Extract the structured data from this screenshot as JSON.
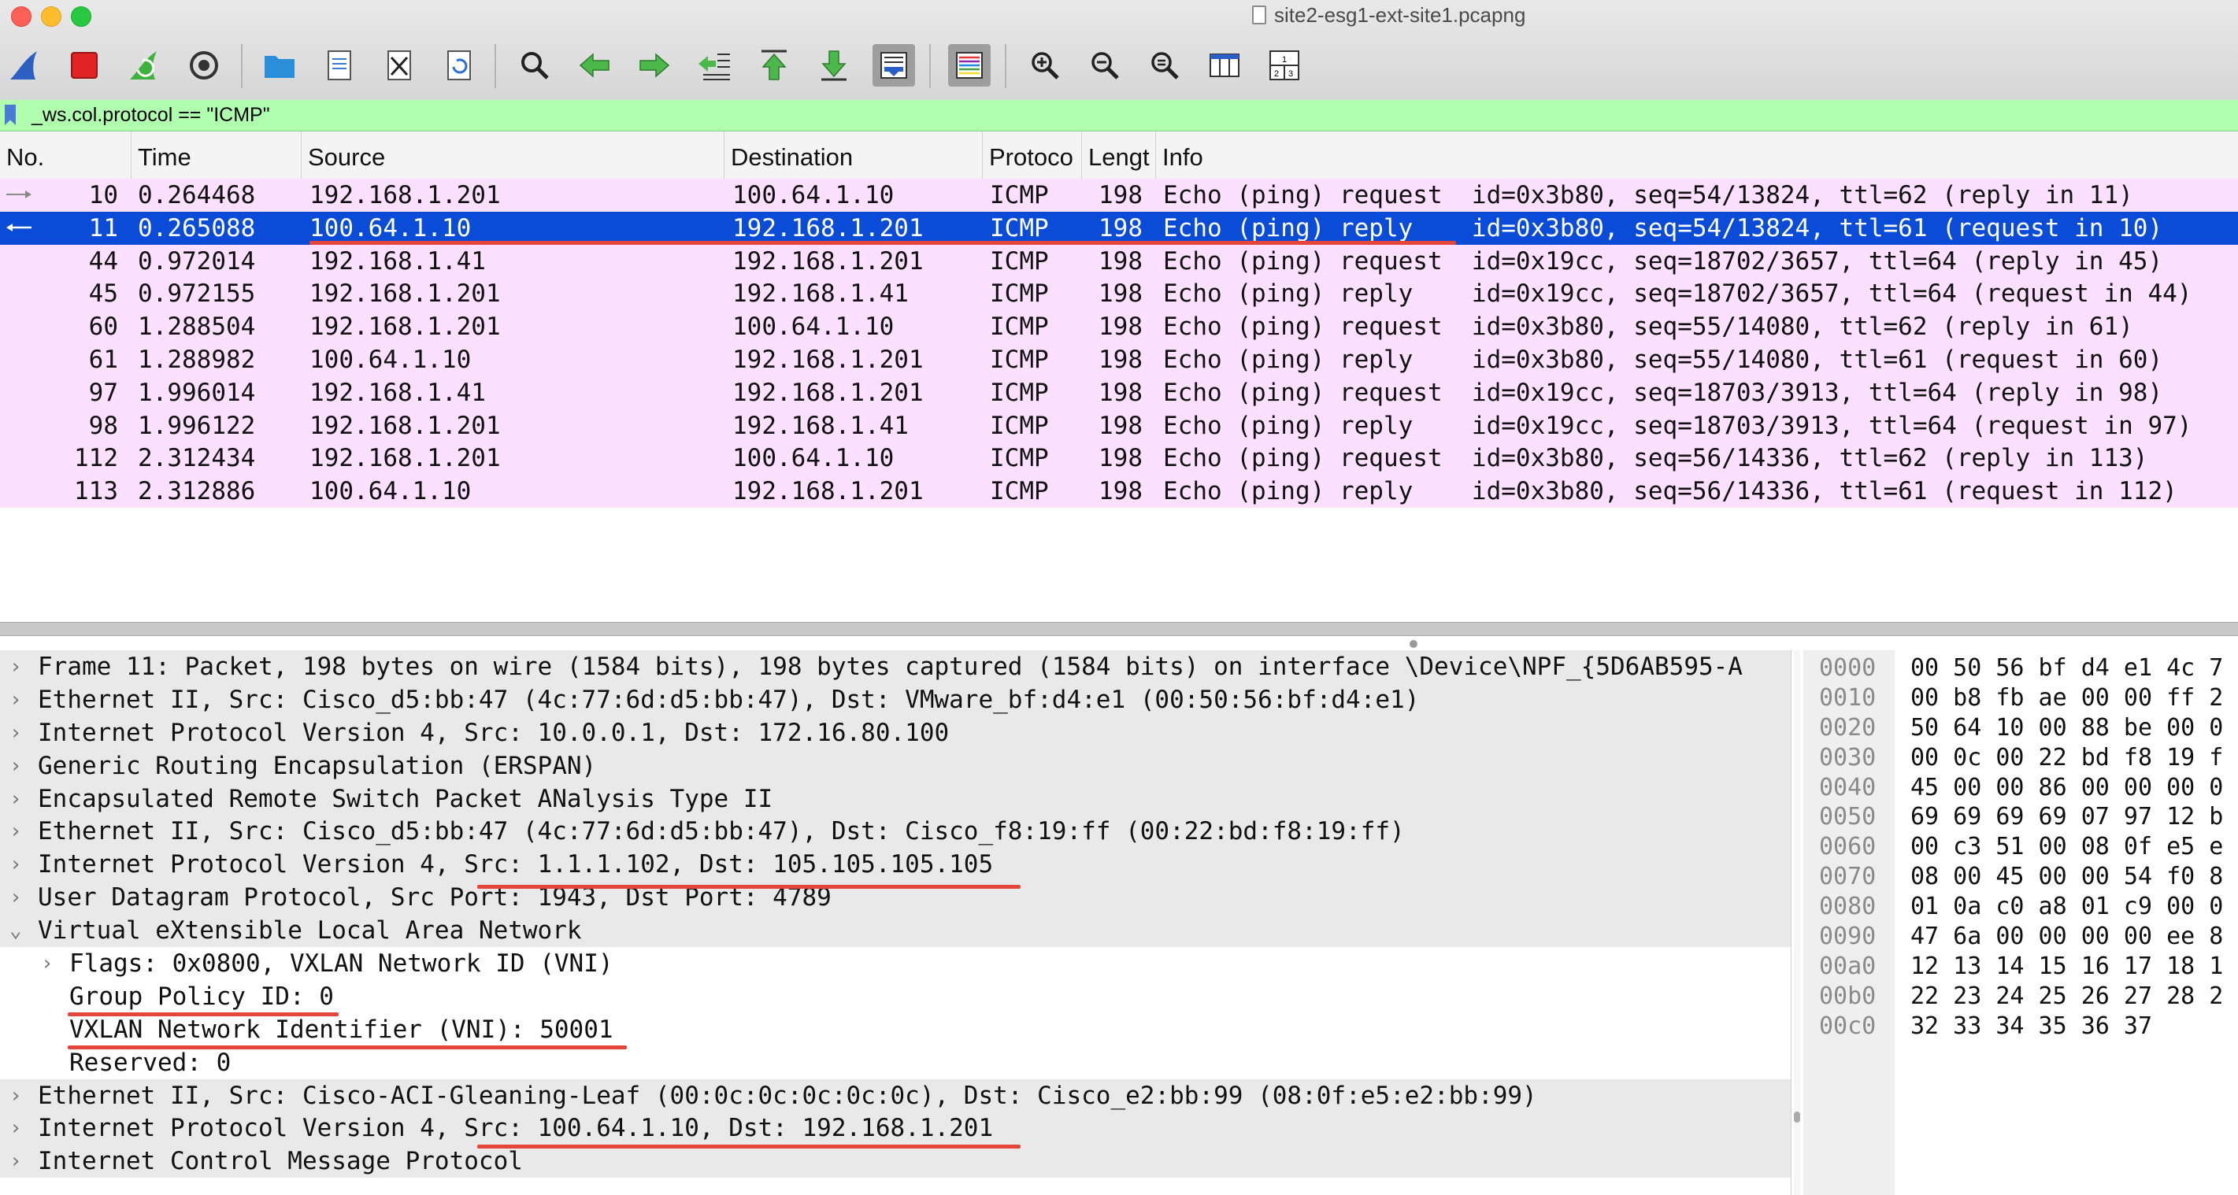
{
  "window": {
    "title": "site2-esg1-ext-site1.pcapng"
  },
  "toolbar": {
    "buttons": [
      {
        "name": "start-capture"
      },
      {
        "name": "stop-capture"
      },
      {
        "name": "restart-capture"
      },
      {
        "name": "capture-options"
      },
      {
        "name": "open-file"
      },
      {
        "name": "save-file"
      },
      {
        "name": "close-file"
      },
      {
        "name": "reload-file"
      },
      {
        "name": "find-packet"
      },
      {
        "name": "go-back"
      },
      {
        "name": "go-forward"
      },
      {
        "name": "go-to-packet"
      },
      {
        "name": "go-first"
      },
      {
        "name": "go-last"
      },
      {
        "name": "autoscroll"
      },
      {
        "name": "colorize"
      },
      {
        "name": "zoom-in"
      },
      {
        "name": "zoom-out"
      },
      {
        "name": "zoom-normal"
      },
      {
        "name": "resize-columns"
      },
      {
        "name": "layout"
      }
    ]
  },
  "filter": {
    "text": "_ws.col.protocol == \"ICMP\""
  },
  "packet_list": {
    "columns": [
      "No.",
      "Time",
      "Source",
      "Destination",
      "Protoco",
      "Lengt",
      "Info"
    ],
    "rows": [
      {
        "no": "10",
        "time": "0.264468",
        "src": "192.168.1.201",
        "dst": "100.64.1.10",
        "proto": "ICMP",
        "len": "198",
        "info": "Echo (ping) request  id=0x3b80, seq=54/13824, ttl=62 (reply in 11)"
      },
      {
        "no": "11",
        "time": "0.265088",
        "src": "100.64.1.10",
        "dst": "192.168.1.201",
        "proto": "ICMP",
        "len": "198",
        "info": "Echo (ping) reply    id=0x3b80, seq=54/13824, ttl=61 (request in 10)"
      },
      {
        "no": "44",
        "time": "0.972014",
        "src": "192.168.1.41",
        "dst": "192.168.1.201",
        "proto": "ICMP",
        "len": "198",
        "info": "Echo (ping) request  id=0x19cc, seq=18702/3657, ttl=64 (reply in 45)"
      },
      {
        "no": "45",
        "time": "0.972155",
        "src": "192.168.1.201",
        "dst": "192.168.1.41",
        "proto": "ICMP",
        "len": "198",
        "info": "Echo (ping) reply    id=0x19cc, seq=18702/3657, ttl=64 (request in 44)"
      },
      {
        "no": "60",
        "time": "1.288504",
        "src": "192.168.1.201",
        "dst": "100.64.1.10",
        "proto": "ICMP",
        "len": "198",
        "info": "Echo (ping) request  id=0x3b80, seq=55/14080, ttl=62 (reply in 61)"
      },
      {
        "no": "61",
        "time": "1.288982",
        "src": "100.64.1.10",
        "dst": "192.168.1.201",
        "proto": "ICMP",
        "len": "198",
        "info": "Echo (ping) reply    id=0x3b80, seq=55/14080, ttl=61 (request in 60)"
      },
      {
        "no": "97",
        "time": "1.996014",
        "src": "192.168.1.41",
        "dst": "192.168.1.201",
        "proto": "ICMP",
        "len": "198",
        "info": "Echo (ping) request  id=0x19cc, seq=18703/3913, ttl=64 (reply in 98)"
      },
      {
        "no": "98",
        "time": "1.996122",
        "src": "192.168.1.201",
        "dst": "192.168.1.41",
        "proto": "ICMP",
        "len": "198",
        "info": "Echo (ping) reply    id=0x19cc, seq=18703/3913, ttl=64 (request in 97)"
      },
      {
        "no": "112",
        "time": "2.312434",
        "src": "192.168.1.201",
        "dst": "100.64.1.10",
        "proto": "ICMP",
        "len": "198",
        "info": "Echo (ping) request  id=0x3b80, seq=56/14336, ttl=62 (reply in 113)"
      },
      {
        "no": "113",
        "time": "2.312886",
        "src": "100.64.1.10",
        "dst": "192.168.1.201",
        "proto": "ICMP",
        "len": "198",
        "info": "Echo (ping) reply    id=0x3b80, seq=56/14336, ttl=61 (request in 112)"
      }
    ]
  },
  "details": {
    "lines": [
      {
        "text": "Frame 11: Packet, 198 bytes on wire (1584 bits), 198 bytes captured (1584 bits) on interface \\Device\\NPF_{5D6AB595-A"
      },
      {
        "text": "Ethernet II, Src: Cisco_d5:bb:47 (4c:77:6d:d5:bb:47), Dst: VMware_bf:d4:e1 (00:50:56:bf:d4:e1)"
      },
      {
        "text": "Internet Protocol Version 4, Src: 10.0.0.1, Dst: 172.16.80.100"
      },
      {
        "text": "Generic Routing Encapsulation (ERSPAN)"
      },
      {
        "text": "Encapsulated Remote Switch Packet ANalysis Type II"
      },
      {
        "text": "Ethernet II, Src: Cisco_d5:bb:47 (4c:77:6d:d5:bb:47), Dst: Cisco_f8:19:ff (00:22:bd:f8:19:ff)"
      },
      {
        "text": "Internet Protocol Version 4, Src: 1.1.1.102, Dst: 105.105.105.105"
      },
      {
        "text": "User Datagram Protocol, Src Port: 1943, Dst Port: 4789"
      },
      {
        "text": "Virtual eXtensible Local Area Network"
      },
      {
        "text": "Flags: 0x0800, VXLAN Network ID (VNI)"
      },
      {
        "text": "Group Policy ID: 0"
      },
      {
        "text": "VXLAN Network Identifier (VNI): 50001"
      },
      {
        "text": "Reserved: 0"
      },
      {
        "text": "Ethernet II, Src: Cisco-ACI-Gleaning-Leaf (00:0c:0c:0c:0c:0c), Dst: Cisco_e2:bb:99 (08:0f:e5:e2:bb:99)"
      },
      {
        "text": "Internet Protocol Version 4, Src: 100.64.1.10, Dst: 192.168.1.201"
      },
      {
        "text": "Internet Control Message Protocol"
      }
    ]
  },
  "hex": {
    "rows": [
      {
        "offset": "0000",
        "bytes": "00 50 56 bf d4 e1 4c 7"
      },
      {
        "offset": "0010",
        "bytes": "00 b8 fb ae 00 00 ff 2"
      },
      {
        "offset": "0020",
        "bytes": "50 64 10 00 88 be 00 0"
      },
      {
        "offset": "0030",
        "bytes": "00 0c 00 22 bd f8 19 f"
      },
      {
        "offset": "0040",
        "bytes": "45 00 00 86 00 00 00 0"
      },
      {
        "offset": "0050",
        "bytes": "69 69 69 69 07 97 12 b"
      },
      {
        "offset": "0060",
        "bytes": "00 c3 51 00 08 0f e5 e"
      },
      {
        "offset": "0070",
        "bytes": "08 00 45 00 00 54 f0 8"
      },
      {
        "offset": "0080",
        "bytes": "01 0a c0 a8 01 c9 00 0"
      },
      {
        "offset": "0090",
        "bytes": "47 6a 00 00 00 00 ee 8"
      },
      {
        "offset": "00a0",
        "bytes": "12 13 14 15 16 17 18 1"
      },
      {
        "offset": "00b0",
        "bytes": "22 23 24 25 26 27 28 2"
      },
      {
        "offset": "00c0",
        "bytes": "32 33 34 35 36 37"
      }
    ]
  },
  "colors": {
    "row_icmp": "#fce0ff",
    "row_selected": "#0a4cd7",
    "filter_bg": "#afffaf",
    "annotation_underline": "#e4463b"
  }
}
